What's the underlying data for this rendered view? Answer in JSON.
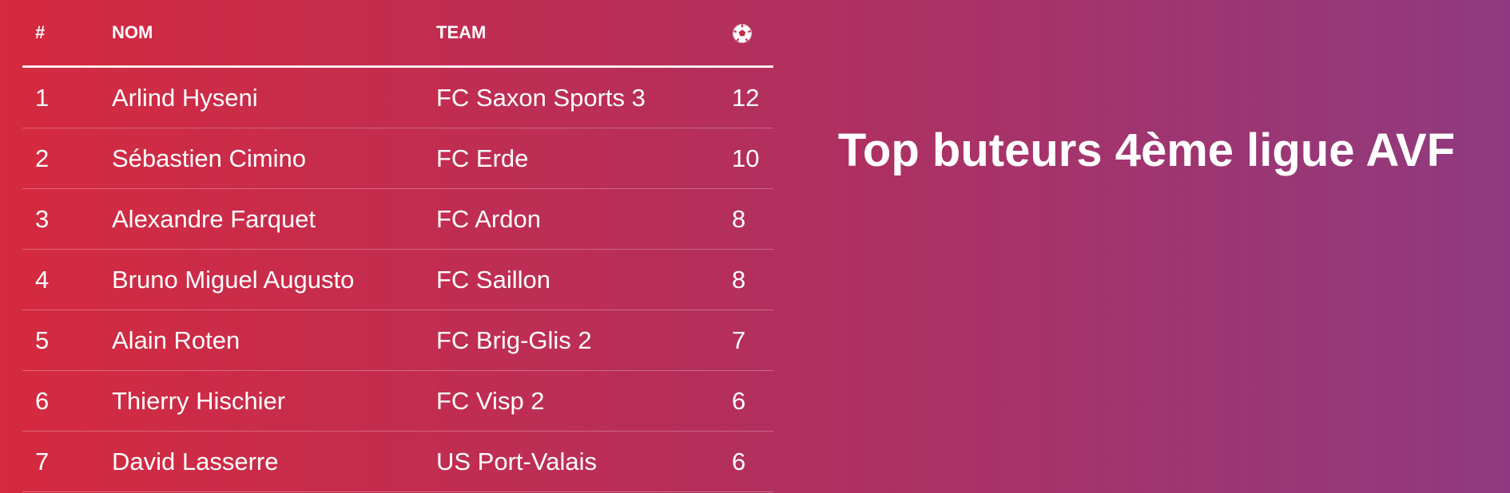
{
  "colors": {
    "gradient_start": "#d52a3f",
    "gradient_mid": "#b32f5d",
    "gradient_end": "#8f3a80",
    "text": "#ffffff"
  },
  "table": {
    "headers": {
      "rank": "#",
      "name": "NOM",
      "team": "TEAM",
      "goals_icon": "soccer-ball-icon"
    },
    "rows": [
      {
        "rank": "1",
        "name": "Arlind Hyseni",
        "team": "FC Saxon Sports 3",
        "goals": "12"
      },
      {
        "rank": "2",
        "name": "Sébastien Cimino",
        "team": "FC Erde",
        "goals": "10"
      },
      {
        "rank": "3",
        "name": "Alexandre Farquet",
        "team": "FC Ardon",
        "goals": "8"
      },
      {
        "rank": "4",
        "name": "Bruno Miguel Augusto",
        "team": "FC Saillon",
        "goals": "8"
      },
      {
        "rank": "5",
        "name": "Alain Roten",
        "team": "FC Brig-Glis 2",
        "goals": "7"
      },
      {
        "rank": "6",
        "name": "Thierry Hischier",
        "team": "FC Visp 2",
        "goals": "6"
      },
      {
        "rank": "7",
        "name": "David Lasserre",
        "team": "US Port-Valais",
        "goals": "6"
      }
    ]
  },
  "headline": "Top buteurs 4ème ligue AVF"
}
